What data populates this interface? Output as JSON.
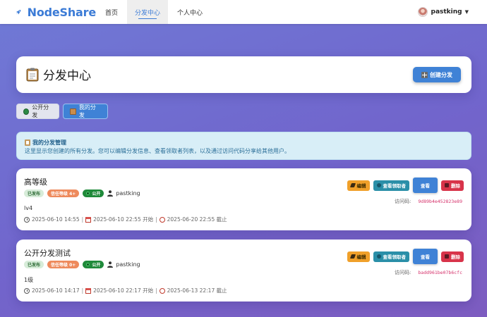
{
  "nav": {
    "brand": "NodeShare",
    "items": [
      {
        "label": "首页"
      },
      {
        "label": "分发中心"
      },
      {
        "label": "个人中心"
      }
    ],
    "user": "pastking"
  },
  "header": {
    "title": "分发中心",
    "create_button": "创建分发"
  },
  "tabs": {
    "public": "公开分发",
    "mine": "我的分发"
  },
  "alert": {
    "title": "我的分发管理",
    "text": "这里显示您创建的所有分发。您可以编辑分发信息、查看领取者列表，以及通过访问代码分享给其他用户。"
  },
  "shares": [
    {
      "title": "高等级",
      "status": "已发布",
      "trust": "信任等级 4+",
      "visibility": "公开",
      "owner": "pastking",
      "description": "lv4",
      "created": "2025-06-10 14:55",
      "start": "2025-06-10 22:55 开始",
      "end": "2025-06-20 22:55 截止",
      "access_label": "访问码:",
      "access_code": "9d89b4e452823e89"
    },
    {
      "title": "公开分发测试",
      "status": "已发布",
      "trust": "信任等级 0+",
      "visibility": "公开",
      "owner": "pastking",
      "description": "1级",
      "created": "2025-06-10 14:17",
      "start": "2025-06-10 22:17 开始",
      "end": "2025-06-13 22:17 截止",
      "access_label": "访问码:",
      "access_code": "badd961be07b6cfc"
    }
  ],
  "actions": {
    "edit": "编辑",
    "claims": "查看领取者",
    "view": "查看",
    "delete": "删除"
  },
  "colors": {
    "primary": "#3f82d6",
    "warning": "#f0a02a",
    "info": "#2a8fa8",
    "danger": "#d8344a",
    "success": "#1f8a3a"
  }
}
